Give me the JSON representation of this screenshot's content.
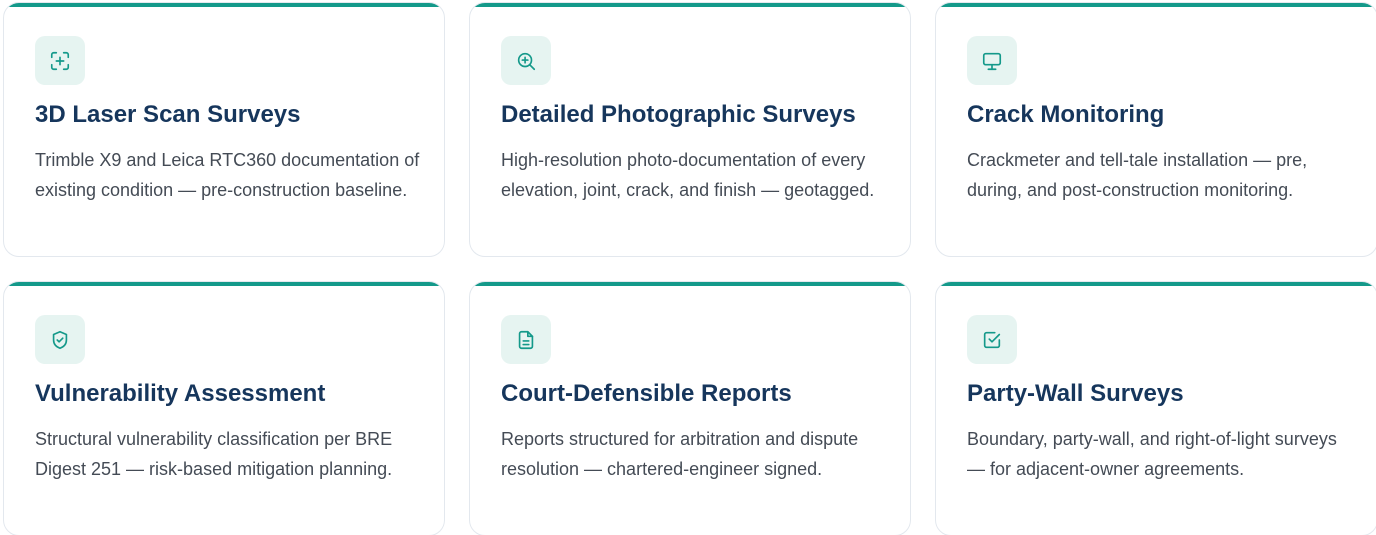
{
  "accent_color": "#14998a",
  "title_color": "#16365c",
  "cards": [
    {
      "icon": "scan-icon",
      "title": "3D Laser Scan Surveys",
      "description": "Trimble X9 and Leica RTC360 documentation of existing condition — pre-construction baseline."
    },
    {
      "icon": "zoom-in-icon",
      "title": "Detailed Photographic Surveys",
      "description": "High-resolution photo-documentation of every elevation, joint, crack, and finish — geotagged."
    },
    {
      "icon": "monitor-icon",
      "title": "Crack Monitoring",
      "description": "Crackmeter and tell-tale installation — pre, during, and post-construction monitoring."
    },
    {
      "icon": "shield-check-icon",
      "title": "Vulnerability Assessment",
      "description": "Structural vulnerability classification per BRE Digest 251 — risk-based mitigation planning."
    },
    {
      "icon": "document-icon",
      "title": "Court-Defensible Reports",
      "description": "Reports structured for arbitration and dispute resolution — chartered-engineer signed."
    },
    {
      "icon": "check-square-icon",
      "title": "Party-Wall Surveys",
      "description": "Boundary, party-wall, and right-of-light surveys — for adjacent-owner agreements."
    }
  ]
}
